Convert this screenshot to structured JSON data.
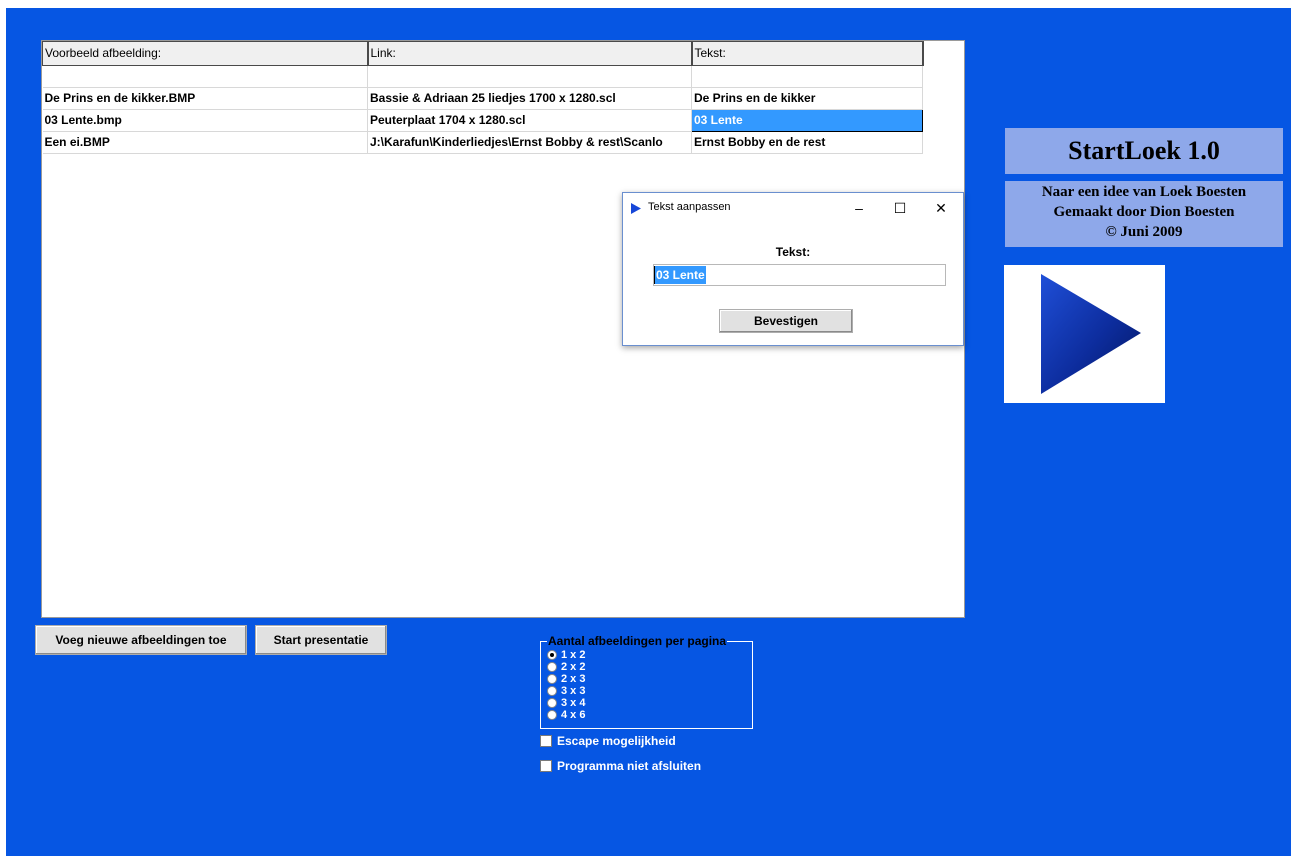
{
  "table": {
    "headers": [
      "Voorbeeld afbeelding:",
      "Link:",
      "Tekst:"
    ],
    "rows": [
      [
        "De Prins en de kikker.BMP",
        "Bassie & Adriaan 25 liedjes 1700  x 1280.scl",
        "De Prins en de kikker"
      ],
      [
        "03 Lente.bmp",
        "Peuterplaat 1704 x 1280.scl",
        "03 Lente"
      ],
      [
        "Een ei.BMP",
        "J:\\Karafun\\Kinderliedjes\\Ernst Bobby & rest\\Scanlo",
        "Ernst Bobby en de rest"
      ]
    ],
    "selected_row": 1,
    "selected_col": 2
  },
  "buttons": {
    "add_images": "Voeg nieuwe afbeeldingen toe",
    "start": "Start presentatie"
  },
  "layout_group": {
    "title": "Aantal afbeeldingen per pagina",
    "options": [
      "1 x 2",
      "2 x 2",
      "2 x 3",
      "3 x 3",
      "3 x 4",
      "4 x 6"
    ],
    "selected": "1 x 2"
  },
  "checkboxes": {
    "escape": {
      "label": "Escape mogelijkheid",
      "checked": false
    },
    "keep_open": {
      "label": "Programma niet afsluiten",
      "checked": false
    }
  },
  "right_panel": {
    "title": "StartLoek 1.0",
    "credit_line1": "Naar een idee van Loek Boesten",
    "credit_line2": "Gemaakt door Dion Boesten",
    "credit_line3": "© Juni 2009",
    "play_icon": "play-triangle-icon"
  },
  "dialog": {
    "title": "Tekst aanpassen",
    "label": "Tekst:",
    "input_value": "03 Lente",
    "confirm": "Bevestigen",
    "minimize": "–",
    "maximize": "☐",
    "close": "✕"
  },
  "colors": {
    "background": "#0656e3",
    "panel": "#8ea8ea",
    "selection": "#3399ff"
  }
}
